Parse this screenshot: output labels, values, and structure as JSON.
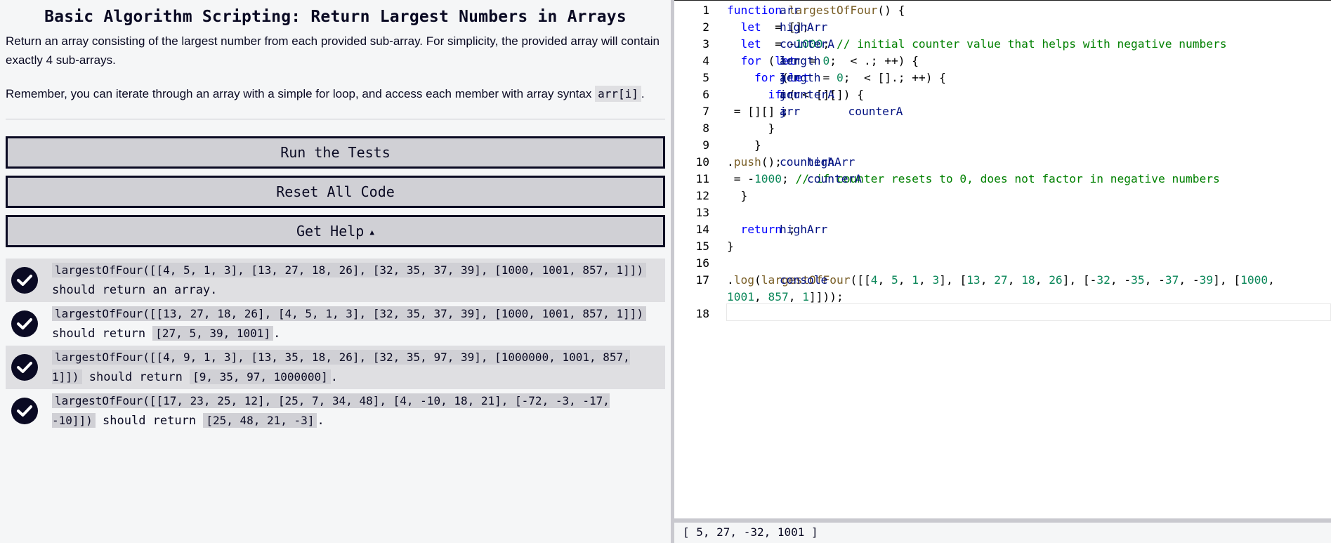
{
  "challenge": {
    "title": "Basic Algorithm Scripting: Return Largest Numbers in Arrays",
    "description_1": "Return an array consisting of the largest number from each provided sub-array. For simplicity, the provided array will contain exactly 4 sub-arrays.",
    "description_2_prefix": "Remember, you can iterate through an array with a simple for loop, and access each member with array syntax ",
    "description_2_code": "arr[i]",
    "description_2_suffix": "."
  },
  "buttons": {
    "run_tests": "Run the Tests",
    "reset_code": "Reset All Code",
    "get_help": "Get Help",
    "get_help_caret": "▲"
  },
  "tests": [
    {
      "code": "largestOfFour([[4, 5, 1, 3], [13, 27, 18, 26], [32, 35, 37, 39], [1000, 1001, 857, 1]])",
      "text": " should return an array.",
      "result": "",
      "end": "",
      "passed": true
    },
    {
      "code": "largestOfFour([[13, 27, 18, 26], [4, 5, 1, 3], [32, 35, 37, 39], [1000, 1001, 857, 1]])",
      "text": " should return ",
      "result": "[27, 5, 39, 1001]",
      "end": ".",
      "passed": true
    },
    {
      "code": "largestOfFour([[4, 9, 1, 3], [13, 35, 18, 26], [32, 35, 97, 39], [1000000, 1001, 857, 1]])",
      "text": " should return ",
      "result": "[9, 35, 97, 1000000]",
      "end": ".",
      "passed": true
    },
    {
      "code": "largestOfFour([[17, 23, 25, 12], [25, 7, 34, 48], [4, -10, 18, 21], [-72, -3, -17, -10]])",
      "text": " should return ",
      "result": "[25, 48, 21, -3]",
      "end": ".",
      "passed": true
    }
  ],
  "editor": {
    "line_numbers": [
      "1",
      "2",
      "3",
      "4",
      "5",
      "6",
      "7",
      "8",
      "9",
      "10",
      "11",
      "12",
      "13",
      "14",
      "15",
      "16",
      "17",
      "18"
    ],
    "lines": [
      [
        [
          "kw",
          "function "
        ],
        [
          "fn",
          "largestOfFour"
        ],
        [
          "pl",
          "("
        ],
        [
          "code",
          "arr"
        ],
        [
          "pl",
          ") {"
        ]
      ],
      [
        [
          "kw",
          "  let "
        ],
        [
          "code",
          "highArr"
        ],
        [
          "pl",
          " = [];"
        ]
      ],
      [
        [
          "kw",
          "  let "
        ],
        [
          "code",
          "counterA"
        ],
        [
          "pl",
          " = -"
        ],
        [
          "num",
          "1000"
        ],
        [
          "pl",
          "; "
        ],
        [
          "cm",
          "// initial counter value that helps with negative numbers"
        ]
      ],
      [
        [
          "kw",
          "  for "
        ],
        [
          "pl",
          "("
        ],
        [
          "kw",
          "let "
        ],
        [
          "code",
          "i"
        ],
        [
          "pl",
          " = "
        ],
        [
          "num",
          "0"
        ],
        [
          "pl",
          "; "
        ],
        [
          "code",
          "i"
        ],
        [
          "pl",
          " < "
        ],
        [
          "code",
          "arr"
        ],
        [
          "pl",
          "."
        ],
        [
          "code",
          "length"
        ],
        [
          "pl",
          "; "
        ],
        [
          "code",
          "i"
        ],
        [
          "pl",
          "++) {"
        ]
      ],
      [
        [
          "kw",
          "    for "
        ],
        [
          "pl",
          "("
        ],
        [
          "kw",
          "let "
        ],
        [
          "code",
          "j"
        ],
        [
          "pl",
          " = "
        ],
        [
          "num",
          "0"
        ],
        [
          "pl",
          "; "
        ],
        [
          "code",
          "j"
        ],
        [
          "pl",
          " < "
        ],
        [
          "code",
          "arr"
        ],
        [
          "pl",
          "["
        ],
        [
          "code",
          "i"
        ],
        [
          "pl",
          "]."
        ],
        [
          "code",
          "length"
        ],
        [
          "pl",
          "; "
        ],
        [
          "code",
          "j"
        ],
        [
          "pl",
          "++) {"
        ]
      ],
      [
        [
          "kw",
          "      if "
        ],
        [
          "pl",
          "("
        ],
        [
          "code",
          "counterA"
        ],
        [
          "pl",
          " < "
        ],
        [
          "code",
          "arr"
        ],
        [
          "pl",
          "["
        ],
        [
          "code",
          "i"
        ],
        [
          "pl",
          "]["
        ],
        [
          "code",
          "j"
        ],
        [
          "pl",
          "]) {"
        ]
      ],
      [
        [
          "code",
          "          counterA"
        ],
        [
          "pl",
          " = "
        ],
        [
          "code",
          "arr"
        ],
        [
          "pl",
          "["
        ],
        [
          "code",
          "i"
        ],
        [
          "pl",
          "]["
        ],
        [
          "code",
          "j"
        ],
        [
          "pl",
          "] ;"
        ]
      ],
      [
        [
          "pl",
          "      }"
        ]
      ],
      [
        [
          "pl",
          "    }"
        ]
      ],
      [
        [
          "code",
          "    highArr"
        ],
        [
          "pl",
          "."
        ],
        [
          "fn",
          "push"
        ],
        [
          "pl",
          "("
        ],
        [
          "code",
          "counterA"
        ],
        [
          "pl",
          ");"
        ]
      ],
      [
        [
          "code",
          "    counterA"
        ],
        [
          "pl",
          " = -"
        ],
        [
          "num",
          "1000"
        ],
        [
          "pl",
          "; "
        ],
        [
          "cm",
          "// if counter resets to 0, does not factor in negative numbers"
        ]
      ],
      [
        [
          "pl",
          "  }"
        ]
      ],
      [
        [
          "pl",
          ""
        ]
      ],
      [
        [
          "kw",
          "  return "
        ],
        [
          "code",
          "highArr"
        ],
        [
          "pl",
          ";"
        ]
      ],
      [
        [
          "pl",
          "}"
        ]
      ],
      [
        [
          "pl",
          ""
        ]
      ],
      [
        [
          "code",
          "console"
        ],
        [
          "pl",
          "."
        ],
        [
          "fn",
          "log"
        ],
        [
          "pl",
          "("
        ],
        [
          "fn",
          "largestOfFour"
        ],
        [
          "pl",
          "([["
        ],
        [
          "num",
          "4"
        ],
        [
          "pl",
          ", "
        ],
        [
          "num",
          "5"
        ],
        [
          "pl",
          ", "
        ],
        [
          "num",
          "1"
        ],
        [
          "pl",
          ", "
        ],
        [
          "num",
          "3"
        ],
        [
          "pl",
          "], ["
        ],
        [
          "num",
          "13"
        ],
        [
          "pl",
          ", "
        ],
        [
          "num",
          "27"
        ],
        [
          "pl",
          ", "
        ],
        [
          "num",
          "18"
        ],
        [
          "pl",
          ", "
        ],
        [
          "num",
          "26"
        ],
        [
          "pl",
          "], [-"
        ],
        [
          "num",
          "32"
        ],
        [
          "pl",
          ", -"
        ],
        [
          "num",
          "35"
        ],
        [
          "pl",
          ", -"
        ],
        [
          "num",
          "37"
        ],
        [
          "pl",
          ", -"
        ],
        [
          "num",
          "39"
        ],
        [
          "pl",
          "], ["
        ],
        [
          "num",
          "1000"
        ],
        [
          "pl",
          ","
        ]
      ],
      [
        [
          "num",
          "1001"
        ],
        [
          "pl",
          ", "
        ],
        [
          "num",
          "857"
        ],
        [
          "pl",
          ", "
        ],
        [
          "num",
          "1"
        ],
        [
          "pl",
          "]]));"
        ]
      ],
      [
        [
          "pl",
          ""
        ]
      ]
    ]
  },
  "console": {
    "output": "[ 5, 27, -32, 1001 ]"
  },
  "colors": {
    "accent": "#0a0a23",
    "panel_bg": "#f5f6f7",
    "button_bg": "#d0d0d5",
    "keyword": "#0000ff",
    "function": "#795e26",
    "number": "#098658",
    "comment": "#008000",
    "identifier": "#001080"
  }
}
